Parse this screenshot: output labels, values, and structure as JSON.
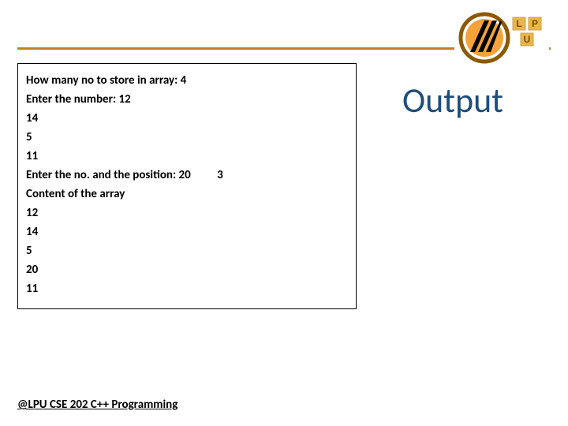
{
  "heading": "Output",
  "footer": "@LPU CSE 202 C++ Programming",
  "console": {
    "line1": "How many no to store in array: 4",
    "line2": "Enter the number: 12",
    "line3": "14",
    "line4": "5",
    "line5": "11",
    "line6a": "Enter the no. and the position:  20",
    "line6b": "3",
    "line7": "Content of the array",
    "line8": "12",
    "line9": "14",
    "line10": "5",
    "line11": "20",
    "line12": "11"
  },
  "colors": {
    "rule": "#c97e1d",
    "heading": "#1f4e79"
  }
}
